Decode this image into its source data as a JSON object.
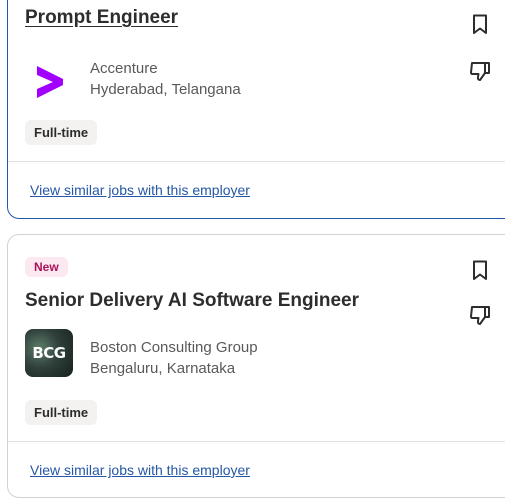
{
  "jobs": [
    {
      "title": "Prompt Engineer",
      "badge": "",
      "company": "Accenture",
      "location": "Hyderabad, Telangana",
      "job_type": "Full-time",
      "similar_link": "View similar jobs with this employer",
      "logo_icon": "accenture-logo",
      "logo_color": "#a100ff"
    },
    {
      "title": "Senior Delivery AI Software Engineer",
      "badge": "New",
      "company": "Boston Consulting Group",
      "location": "Bengaluru, Karnataka",
      "job_type": "Full-time",
      "similar_link": "View similar jobs with this employer",
      "logo_icon": "bcg-logo",
      "logo_text": "BCG"
    }
  ],
  "icons": {
    "save": "bookmark-icon",
    "not_interested": "thumbs-down-icon"
  },
  "colors": {
    "link": "#2557a7",
    "new_badge_bg": "#fce8f1",
    "new_badge_text": "#a9125a",
    "active_card_border": "#2557a7"
  }
}
